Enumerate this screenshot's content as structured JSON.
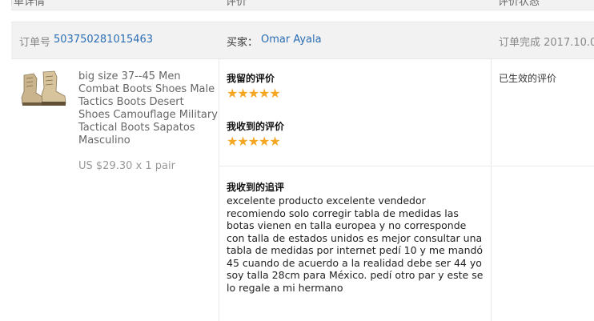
{
  "header": {
    "col_order_details": "订单详情",
    "col_review": "评价",
    "col_review_status": "评价状态"
  },
  "order": {
    "order_no_label": "订单号",
    "order_no": "503750281015463",
    "buyer_label": "买家：",
    "buyer_name": "Omar Ayala",
    "completion_text": "订单完成 2017.10.0"
  },
  "product": {
    "image_icon": "tactical-boots-image",
    "title": "big size 37--45 Men Combat Boots Shoes Male Tactics Boots Desert Shoes Camouflage Military Tactical Boots Sapatos Masculino",
    "price": "US $29.30 x 1 pair"
  },
  "reviews": {
    "my_review_label": "我留的评价",
    "my_review_stars": 5,
    "received_review_label": "我收到的评价",
    "received_review_stars": 5,
    "followup_label": "我收到的追评",
    "followup_text": "excelente producto excelente vendedor recomiendo solo corregir tabla de medidas las botas vienen en talla europea y no corresponde con talla de estados unidos es mejor consultar una tabla de medidas por internet pedí 10 y me mandó 45 cuando de acuerdo a la realidad debe ser 44 yo soy talla 28cm para México. pedí otro par y este se lo regale a mi hermano"
  },
  "status": {
    "text": "已生效的评价"
  },
  "colors": {
    "link": "#2a6db5",
    "star": "#f5a623",
    "row_bg": "#f2f2f2"
  }
}
